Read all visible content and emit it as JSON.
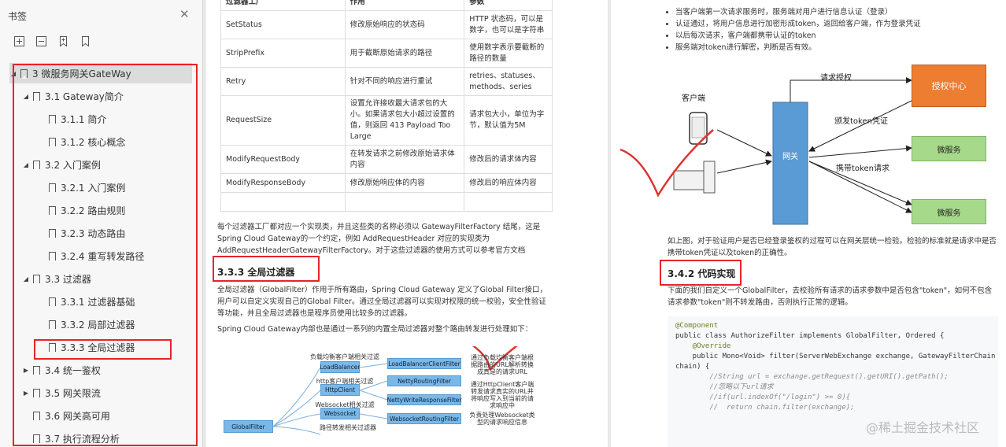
{
  "sidebar": {
    "title": "书签",
    "toolbar_icons": [
      "expand-all-icon",
      "collapse-all-icon",
      "bookmark-add-icon",
      "bookmark-icon"
    ],
    "items": [
      {
        "label": "3 微服务网关GateWay",
        "level": 0,
        "expanded": true
      },
      {
        "label": "3.1 Gateway简介",
        "level": 1,
        "expanded": true
      },
      {
        "label": "3.1.1 简介",
        "level": 2
      },
      {
        "label": "3.1.2 核心概念",
        "level": 2
      },
      {
        "label": "3.2 入门案例",
        "level": 1,
        "expanded": true
      },
      {
        "label": "3.2.1 入门案例",
        "level": 2
      },
      {
        "label": "3.2.2 路由规则",
        "level": 2
      },
      {
        "label": "3.2.3 动态路由",
        "level": 2
      },
      {
        "label": "3.2.4 重写转发路径",
        "level": 2
      },
      {
        "label": "3.3 过滤器",
        "level": 1,
        "expanded": true
      },
      {
        "label": "3.3.1 过滤器基础",
        "level": 2
      },
      {
        "label": "3.3.2 局部过滤器",
        "level": 2
      },
      {
        "label": "3.3.3 全局过滤器",
        "level": 2,
        "selected": true
      },
      {
        "label": "3.4 统一鉴权",
        "level": 1,
        "expanded": false
      },
      {
        "label": "3.5 网关限流",
        "level": 1,
        "expanded": false
      },
      {
        "label": "3.6 网关高可用",
        "level": 1
      },
      {
        "label": "3.7 执行流程分析",
        "level": 1
      }
    ]
  },
  "page1": {
    "table_header": [
      "过滤器工厂",
      "作用",
      "参数"
    ],
    "rows": [
      [
        "SetStatus",
        "修改原始响应的状态码",
        "HTTP 状态码，可以是数字，也可以是字符串"
      ],
      [
        "StripPrefix",
        "用于截断原始请求的路径",
        "使用数字表示要截断的路径的数量"
      ],
      [
        "Retry",
        "针对不同的响应进行重试",
        "retries、statuses、methods、series"
      ],
      [
        "RequestSize",
        "设置允许接收最大请求包的大小。如果请求包大小超过设置的值，则返回 413 Payload Too Large",
        "请求包大小，单位为字节，默认值为5M"
      ],
      [
        "ModifyRequestBody",
        "在转发请求之前修改原始请求体内容",
        "修改后的请求体内容"
      ],
      [
        "ModifyResponseBody",
        "修改原始响应体的内容",
        "修改后的响应体内容"
      ],
      [
        "",
        "",
        ""
      ]
    ],
    "para1": "每个过滤器工厂都对应一个实现类，并且这些类的名称必须以 GatewayFilterFactory 结尾，这是 Spring Cloud Gateway的一个约定，例如 AddRequestHeader 对应的实现类为 AddRequestHeaderGatewayFilterFactory。对于这些过滤器的使用方式可以参考官方文档",
    "heading": "3.3.3 全局过滤器",
    "para2": "全局过滤器（GlobalFilter）作用于所有路由，Spring Cloud Gateway 定义了Global Filter接口，用户可以自定义实现自己的Global Filter。通过全局过滤器可以实现对权限的统一校验，安全性验证等功能，并且全局过滤器也是程序员使用比较多的过滤器。",
    "para3": "Spring Cloud Gateway内部也是通过一系列的内置全局过滤器对整个路由转发进行处理如下：",
    "diagram": {
      "labels": [
        "负载均衡客户端相关过滤器",
        "http客户端相关过滤器",
        "Websocket相关过滤器",
        "路径转发相关过滤器"
      ],
      "left_boxes": [
        "LoadBalancer",
        "HttpClient",
        "Websocket"
      ],
      "right_boxes": [
        "LoadBalancerClientFilter",
        "NettyRoutingFilter",
        "NettyWriteResponseFilter",
        "WebsocketRoutingFilter"
      ],
      "root": "GlobalFilter",
      "notes": [
        "通过负载均衡客户端根据路由的URL解析转换成真是的请求URL",
        "通过HttpClient客户端转发请求真实的URL并将响应写入到当前的请求响应中",
        "负责处理Websocket类型的请求响应信息"
      ]
    }
  },
  "page2": {
    "bullets": [
      "当客户端第一次请求服务时，服务端对用户进行信息认证（登录）",
      "认证通过，将用户信息进行加密形成token，返回给客户端，作为登录凭证",
      "以后每次请求，客户端都携带认证的token",
      "服务端对token进行解密，判断是否有效。"
    ],
    "diagram": {
      "client_label": "客户端",
      "gateway": "网关",
      "auth": "授权中心",
      "service1": "微服务",
      "service2": "微服务",
      "arrow_request_auth": "请求授权",
      "arrow_issue_token": "颁发token凭证",
      "arrow_carry_token": "携带token请求"
    },
    "para1": "如上图，对于验证用户是否已经登录鉴权的过程可以在网关层统一检验。检验的标准就是请求中是否携带token凭证以及token的正确性。",
    "heading": "3.4.2 代码实现",
    "para2": "下面的我们自定义一个GlobalFilter，去校验所有请求的请求参数中是否包含\"token\"，如何不包含请求参数\"token\"则不转发路由，否则执行正常的逻辑。",
    "code": [
      "@Component",
      "public class AuthorizeFilter implements GlobalFilter, Ordered {",
      "",
      "    @Override",
      "    public Mono<Void> filter(ServerWebExchange exchange, GatewayFilterChain",
      "chain) {",
      "",
      "        //String url = exchange.getRequest().getURI().getPath();",
      "        //忽略以下url请求",
      "        //if(url.indexOf(\"/login\") >= 0){",
      "        //  return chain.filter(exchange);"
    ]
  },
  "watermark": "@稀土掘金技术社区",
  "colors": {
    "annotation_red": "#e8232a",
    "gateway_blue": "#5b9bd5",
    "auth_orange": "#ed7d31",
    "service_green": "#a6d98a"
  }
}
